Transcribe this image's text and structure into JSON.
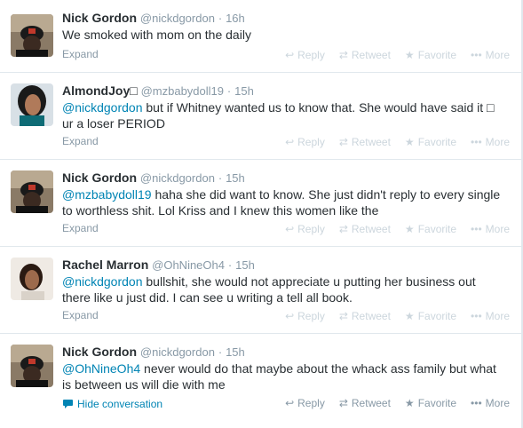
{
  "actions": {
    "reply": "Reply",
    "retweet": "Retweet",
    "favorite": "Favorite",
    "more": "More"
  },
  "tweets": [
    {
      "fullname": "Nick Gordon",
      "username": "@nickdgordon",
      "dot": "·",
      "time": "16h",
      "text_plain": "We smoked with mom on the daily",
      "footer": "Expand"
    },
    {
      "fullname": "AlmondJoy□",
      "username": "@mzbabydoll19",
      "dot": "·",
      "time": "15h",
      "mention": "@nickdgordon",
      "text_line1": " but if Whitney wanted us to know that. She would have said it □",
      "text_line2": "ur a loser PERIOD",
      "footer": "Expand"
    },
    {
      "fullname": "Nick Gordon",
      "username": "@nickdgordon",
      "dot": "·",
      "time": "15h",
      "mention": "@mzbabydoll19",
      "text_line1": " haha she did want to know. She just didn't reply to every single",
      "text_line2": "to worthless shit. Lol Kriss and I knew this women like the",
      "footer": "Expand"
    },
    {
      "fullname": "Rachel Marron",
      "username": "@OhNineOh4",
      "dot": "·",
      "time": "15h",
      "mention": "@nickdgordon",
      "text_line1": " bullshit, she would not appreciate u putting her business out",
      "text_line2": "there like u just did. I can see u writing a tell all book.",
      "footer": "Expand"
    },
    {
      "fullname": "Nick Gordon",
      "username": "@nickdgordon",
      "dot": "·",
      "time": "15h",
      "mention": "@OhNineOh4",
      "text_line1": " never would do that maybe about the whack ass family but what",
      "text_line2": "is between us will die with me",
      "footer": "Hide conversation"
    }
  ]
}
